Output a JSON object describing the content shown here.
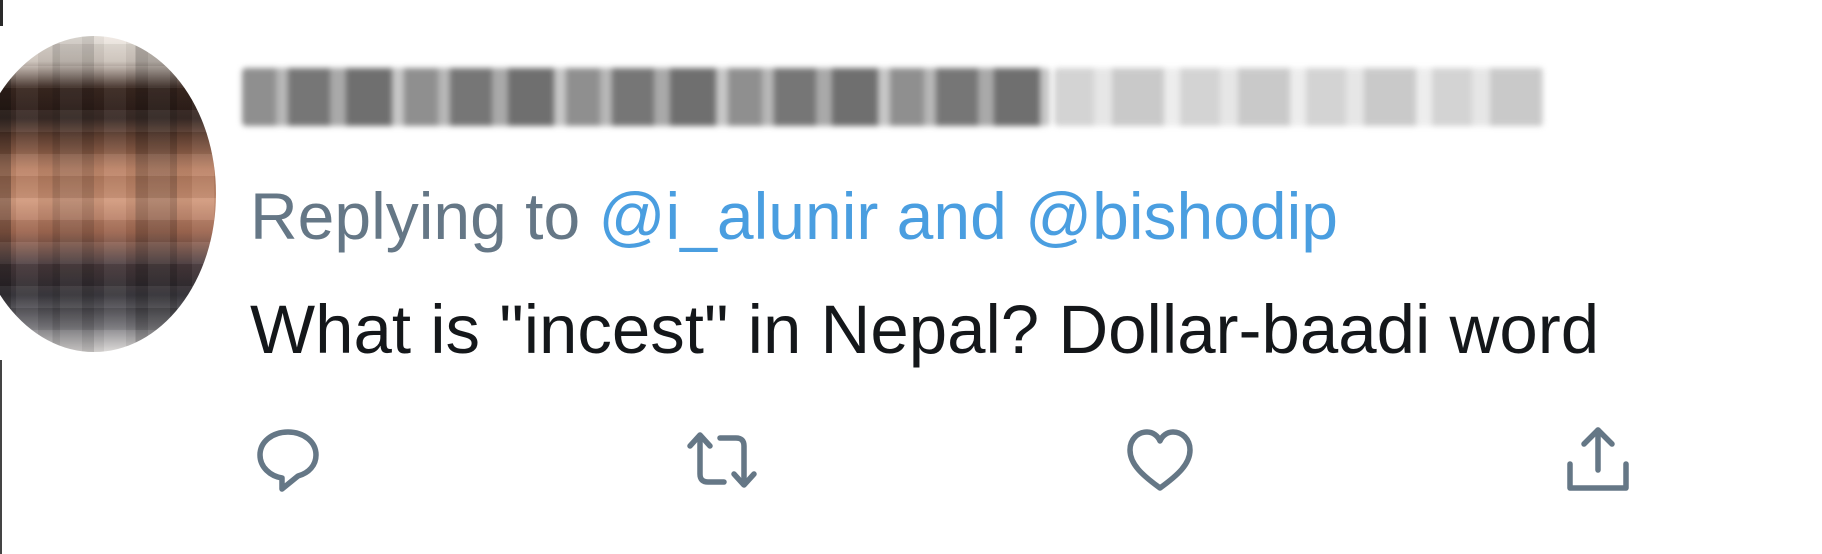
{
  "tweet": {
    "display_name": "",
    "handle_and_time": "",
    "replying_prefix": "Replying to",
    "mentions": "@i_alunir and @bishodip",
    "text": "What is \"incest\" in Nepal? Dollar-baadi word"
  },
  "actions": {
    "reply_icon": "reply-icon",
    "retweet_icon": "retweet-icon",
    "like_icon": "heart-icon",
    "share_icon": "share-icon"
  },
  "colors": {
    "secondary_text": "#657786",
    "mention": "#1da1f2",
    "primary_text": "#14171a",
    "icon": "#657786"
  }
}
